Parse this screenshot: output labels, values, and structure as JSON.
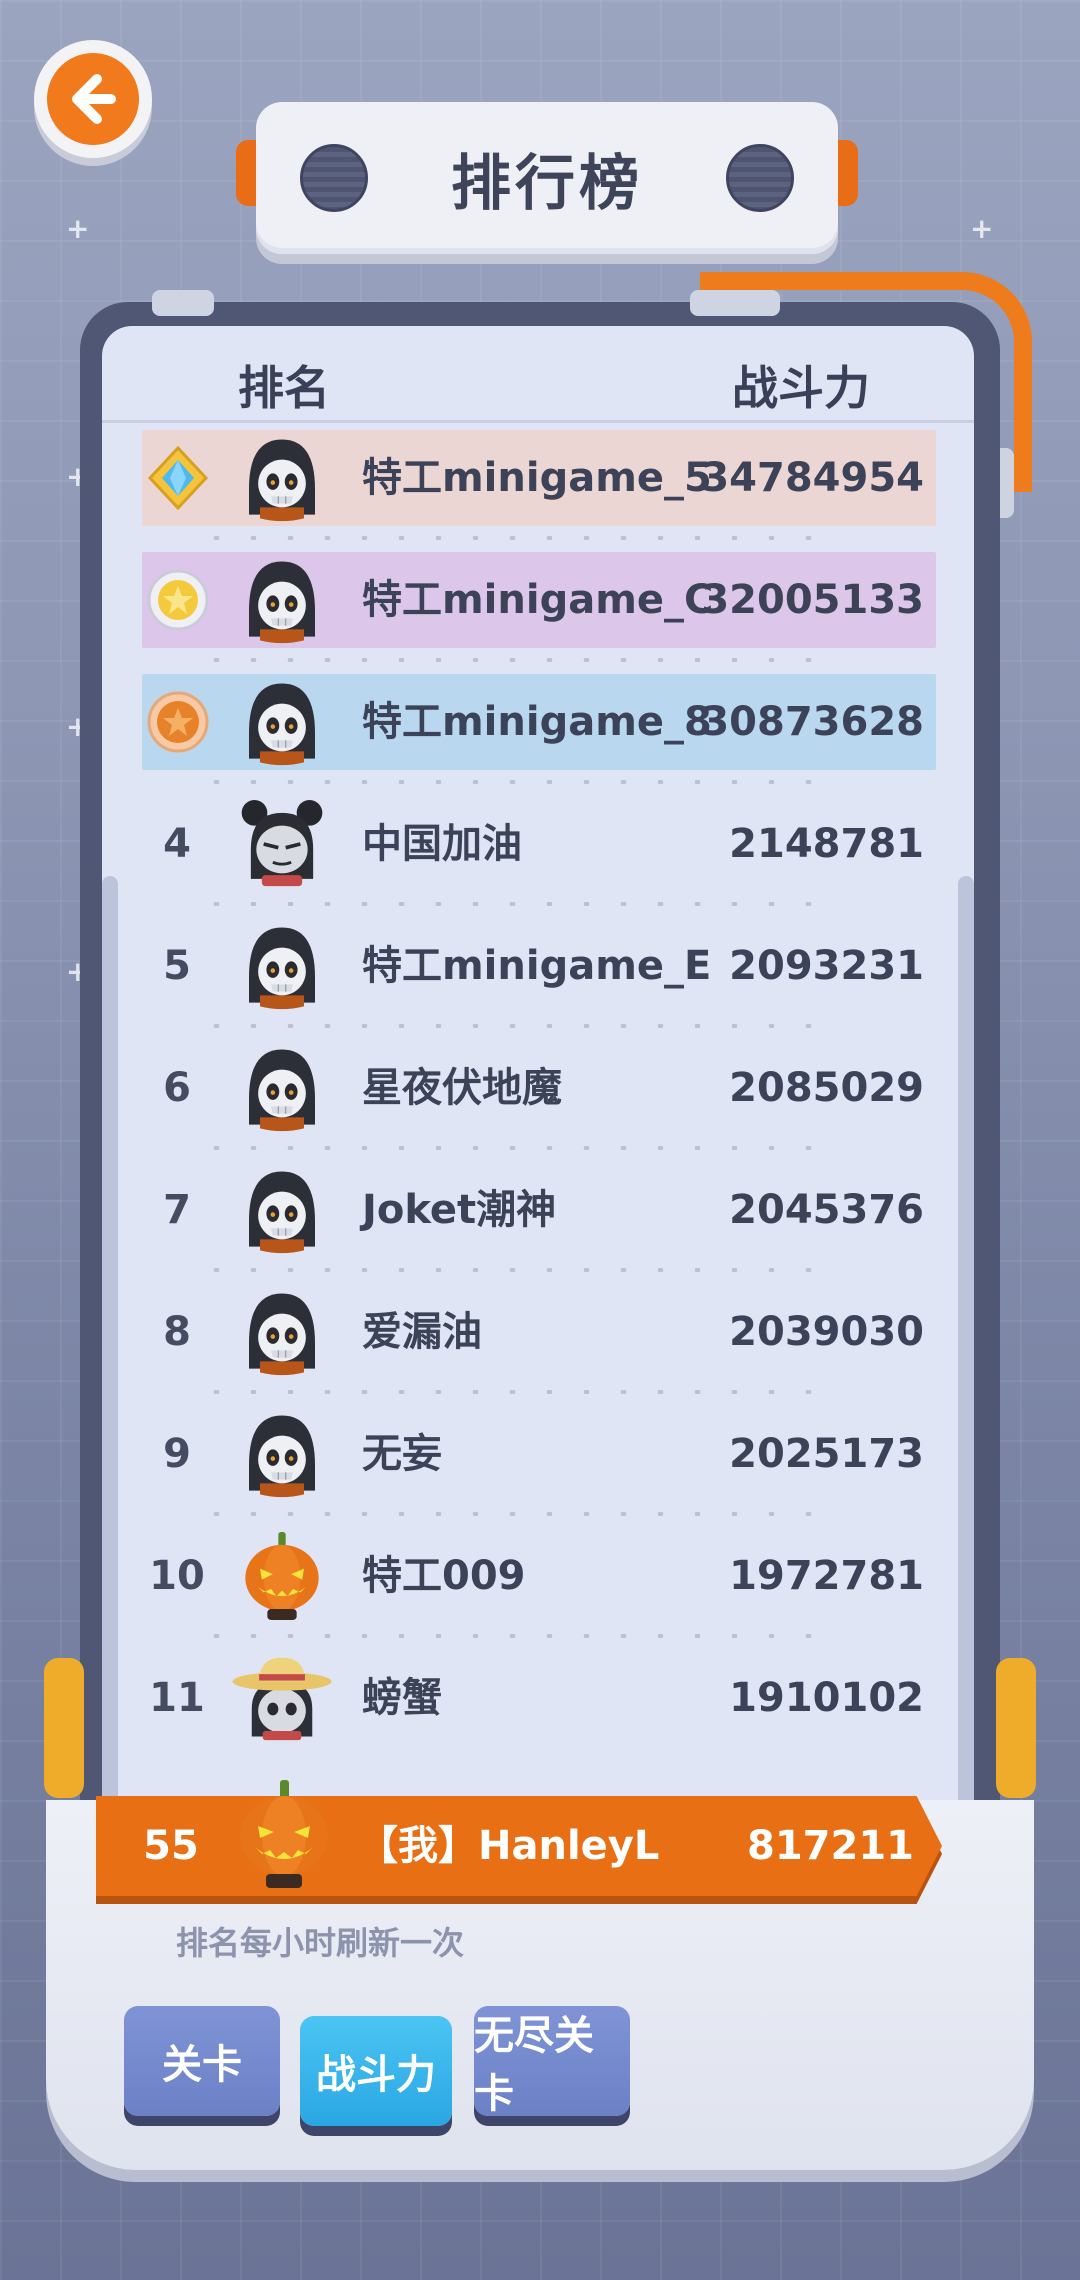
{
  "title": "排行榜",
  "header": {
    "rank_col": "排名",
    "power_col": "战斗力"
  },
  "rows": [
    {
      "rank": "",
      "name": "特工minigame_5",
      "score": "34784954",
      "medal": "diamond-medal-icon",
      "highlight": "#ecd6d4",
      "avatar": "skull-avatar"
    },
    {
      "rank": "",
      "name": "特工minigame_C",
      "score": "32005133",
      "medal": "gold-medal-icon",
      "highlight": "#dcc7ea",
      "avatar": "skull-avatar"
    },
    {
      "rank": "",
      "name": "特工minigame_8",
      "score": "30873628",
      "medal": "bronze-medal-icon",
      "highlight": "#b9d8f0",
      "avatar": "skull-avatar"
    },
    {
      "rank": "4",
      "name": "中国加油",
      "score": "2148781",
      "avatar": "mouse-ears-avatar"
    },
    {
      "rank": "5",
      "name": "特工minigame_E",
      "score": "2093231",
      "avatar": "skull-avatar"
    },
    {
      "rank": "6",
      "name": "星夜伏地魔",
      "score": "2085029",
      "avatar": "skull-avatar"
    },
    {
      "rank": "7",
      "name": "Joket潮神",
      "score": "2045376",
      "avatar": "skull-avatar"
    },
    {
      "rank": "8",
      "name": "爱漏油",
      "score": "2039030",
      "avatar": "skull-avatar"
    },
    {
      "rank": "9",
      "name": "无妄",
      "score": "2025173",
      "avatar": "skull-avatar"
    },
    {
      "rank": "10",
      "name": "特工009",
      "score": "1972781",
      "avatar": "pumpkin-avatar"
    },
    {
      "rank": "11",
      "name": "螃蟹",
      "score": "1910102",
      "avatar": "straw-hat-avatar"
    }
  ],
  "me": {
    "rank": "55",
    "name": "【我】HanleyL",
    "score": "817211",
    "avatar": "pumpkin-avatar"
  },
  "note": "排名每小时刷新一次",
  "tabs": [
    {
      "label": "关卡",
      "active": false
    },
    {
      "label": "战斗力",
      "active": true
    },
    {
      "label": "无尽关卡",
      "active": false
    }
  ],
  "colors": {
    "accent": "#e96f14",
    "panel": "#dfe5f5",
    "board": "#4f5775",
    "active_tab": "#2aa6e4"
  }
}
